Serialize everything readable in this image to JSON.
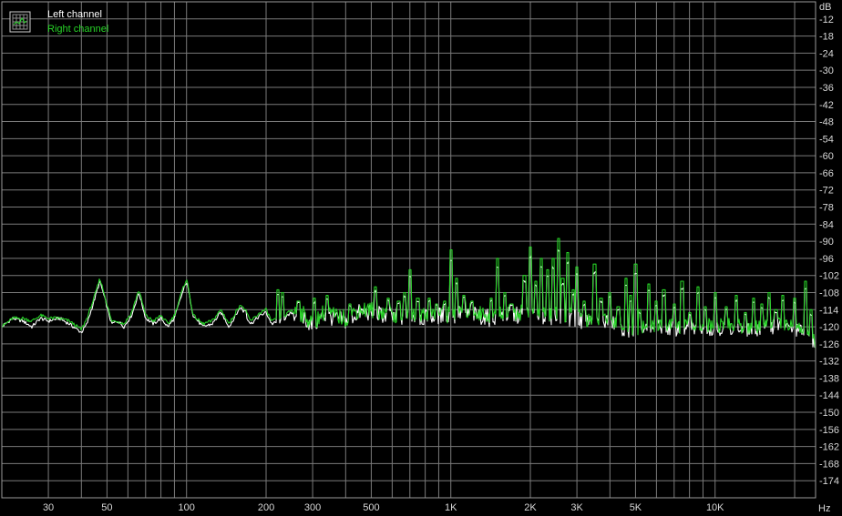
{
  "chart_data": {
    "type": "line",
    "xscale": "log",
    "xlim": [
      20,
      24000
    ],
    "ylim": [
      -180,
      -6
    ],
    "yunit": "dB",
    "xunit": "Hz",
    "grid": true,
    "legend_position": "top-left",
    "background_color": "#000000",
    "grid_color": "#7a7a7a",
    "y_ticks": [
      -12,
      -18,
      -24,
      -30,
      -36,
      -42,
      -48,
      -54,
      -60,
      -66,
      -72,
      -78,
      -84,
      -90,
      -96,
      -102,
      -108,
      -114,
      -120,
      -126,
      -132,
      -138,
      -144,
      -150,
      -156,
      -162,
      -168,
      -174
    ],
    "x_ticks": [
      {
        "value": 30,
        "label": "30"
      },
      {
        "value": 50,
        "label": "50"
      },
      {
        "value": 100,
        "label": "100"
      },
      {
        "value": 200,
        "label": "200"
      },
      {
        "value": 300,
        "label": "300"
      },
      {
        "value": 500,
        "label": "500"
      },
      {
        "value": 1000,
        "label": "1K"
      },
      {
        "value": 2000,
        "label": "2K"
      },
      {
        "value": 3000,
        "label": "3K"
      },
      {
        "value": 5000,
        "label": "5K"
      },
      {
        "value": 10000,
        "label": "10K"
      }
    ],
    "series": [
      {
        "name": "Left channel",
        "color": "#ffffff",
        "points": [
          [
            20,
            -120
          ],
          [
            22,
            -117
          ],
          [
            24,
            -118
          ],
          [
            26,
            -120
          ],
          [
            28,
            -117
          ],
          [
            30,
            -118
          ],
          [
            33,
            -117
          ],
          [
            36,
            -119
          ],
          [
            40,
            -122
          ],
          [
            42,
            -119
          ],
          [
            45,
            -110
          ],
          [
            47,
            -104
          ],
          [
            49,
            -110
          ],
          [
            52,
            -119
          ],
          [
            55,
            -118
          ],
          [
            58,
            -120
          ],
          [
            62,
            -116
          ],
          [
            66,
            -108
          ],
          [
            70,
            -117
          ],
          [
            75,
            -119
          ],
          [
            80,
            -117
          ],
          [
            85,
            -120
          ],
          [
            90,
            -117
          ],
          [
            95,
            -110
          ],
          [
            100,
            -104
          ],
          [
            106,
            -116
          ],
          [
            115,
            -120
          ],
          [
            125,
            -119
          ],
          [
            135,
            -115
          ],
          [
            145,
            -120
          ],
          [
            160,
            -113
          ],
          [
            175,
            -119
          ],
          [
            190,
            -116
          ],
          [
            200,
            -115
          ],
          [
            210,
            -119
          ],
          [
            230,
            -118
          ],
          [
            250,
            -115
          ],
          [
            280,
            -117
          ],
          [
            300,
            -120
          ],
          [
            330,
            -116
          ],
          [
            360,
            -117
          ],
          [
            400,
            -118
          ],
          [
            450,
            -115
          ],
          [
            500,
            -115
          ],
          [
            560,
            -116
          ],
          [
            630,
            -117
          ],
          [
            700,
            -116
          ],
          [
            800,
            -117
          ],
          [
            900,
            -116
          ],
          [
            1000,
            -117
          ],
          [
            1100,
            -115
          ],
          [
            1250,
            -116
          ],
          [
            1400,
            -117
          ],
          [
            1600,
            -116
          ],
          [
            1800,
            -116
          ],
          [
            2000,
            -115
          ],
          [
            2200,
            -116
          ],
          [
            2500,
            -117
          ],
          [
            2800,
            -117
          ],
          [
            3200,
            -118
          ],
          [
            3600,
            -118
          ],
          [
            4000,
            -118
          ],
          [
            4500,
            -121
          ],
          [
            5000,
            -122
          ],
          [
            5600,
            -121
          ],
          [
            6300,
            -120
          ],
          [
            7000,
            -121
          ],
          [
            8000,
            -121
          ],
          [
            9000,
            -120
          ],
          [
            10000,
            -121
          ],
          [
            11200,
            -120
          ],
          [
            12500,
            -121
          ],
          [
            14000,
            -121
          ],
          [
            16000,
            -120
          ],
          [
            18000,
            -120
          ],
          [
            20000,
            -121
          ],
          [
            22000,
            -122
          ],
          [
            24000,
            -127
          ]
        ]
      },
      {
        "name": "Right channel",
        "color": "#27d327",
        "points": [
          [
            20,
            -120
          ],
          [
            22,
            -117
          ],
          [
            24,
            -117
          ],
          [
            26,
            -118
          ],
          [
            28,
            -116
          ],
          [
            30,
            -117
          ],
          [
            33,
            -117
          ],
          [
            36,
            -118
          ],
          [
            40,
            -121
          ],
          [
            42,
            -117
          ],
          [
            45,
            -109
          ],
          [
            47,
            -103
          ],
          [
            49,
            -109
          ],
          [
            52,
            -118
          ],
          [
            55,
            -118
          ],
          [
            58,
            -119
          ],
          [
            62,
            -115
          ],
          [
            66,
            -107
          ],
          [
            70,
            -116
          ],
          [
            75,
            -118
          ],
          [
            80,
            -116
          ],
          [
            85,
            -119
          ],
          [
            90,
            -116
          ],
          [
            95,
            -109
          ],
          [
            100,
            -103
          ],
          [
            106,
            -116
          ],
          [
            115,
            -119
          ],
          [
            125,
            -118
          ],
          [
            135,
            -114
          ],
          [
            145,
            -119
          ],
          [
            160,
            -112
          ],
          [
            175,
            -118
          ],
          [
            190,
            -115
          ],
          [
            200,
            -114
          ],
          [
            210,
            -118
          ],
          [
            230,
            -117
          ],
          [
            250,
            -114
          ],
          [
            280,
            -116
          ],
          [
            300,
            -119
          ],
          [
            330,
            -115
          ],
          [
            360,
            -116
          ],
          [
            400,
            -117
          ],
          [
            450,
            -114
          ],
          [
            500,
            -114
          ],
          [
            560,
            -115
          ],
          [
            630,
            -116
          ],
          [
            700,
            -115
          ],
          [
            800,
            -116
          ],
          [
            900,
            -115
          ],
          [
            1000,
            -116
          ],
          [
            1100,
            -114
          ],
          [
            1250,
            -115
          ],
          [
            1400,
            -116
          ],
          [
            1600,
            -115
          ],
          [
            1800,
            -115
          ],
          [
            2000,
            -114
          ],
          [
            2200,
            -115
          ],
          [
            2500,
            -116
          ],
          [
            2800,
            -116
          ],
          [
            3200,
            -117
          ],
          [
            3600,
            -117
          ],
          [
            4000,
            -117
          ],
          [
            4500,
            -120
          ],
          [
            5000,
            -121
          ],
          [
            5600,
            -120
          ],
          [
            6300,
            -119
          ],
          [
            7000,
            -120
          ],
          [
            8000,
            -120
          ],
          [
            9000,
            -119
          ],
          [
            10000,
            -120
          ],
          [
            11200,
            -119
          ],
          [
            12500,
            -120
          ],
          [
            14000,
            -120
          ],
          [
            16000,
            -119
          ],
          [
            18000,
            -119
          ],
          [
            20000,
            -120
          ],
          [
            22000,
            -121
          ],
          [
            24000,
            -126
          ]
        ]
      }
    ],
    "peaks": [
      {
        "f": 167,
        "db": -114
      },
      {
        "f": 222,
        "db": -107
      },
      {
        "f": 230,
        "db": -108
      },
      {
        "f": 265,
        "db": -111
      },
      {
        "f": 305,
        "db": -110
      },
      {
        "f": 340,
        "db": -109
      },
      {
        "f": 415,
        "db": -112
      },
      {
        "f": 520,
        "db": -106
      },
      {
        "f": 580,
        "db": -110
      },
      {
        "f": 635,
        "db": -111
      },
      {
        "f": 670,
        "db": -108
      },
      {
        "f": 700,
        "db": -100
      },
      {
        "f": 750,
        "db": -110
      },
      {
        "f": 830,
        "db": -110
      },
      {
        "f": 880,
        "db": -112
      },
      {
        "f": 950,
        "db": -111
      },
      {
        "f": 1000,
        "db": -93
      },
      {
        "f": 1050,
        "db": -103
      },
      {
        "f": 1120,
        "db": -109
      },
      {
        "f": 1200,
        "db": -111
      },
      {
        "f": 1420,
        "db": -110
      },
      {
        "f": 1500,
        "db": -96
      },
      {
        "f": 1600,
        "db": -108
      },
      {
        "f": 1700,
        "db": -112
      },
      {
        "f": 1900,
        "db": -102
      },
      {
        "f": 2000,
        "db": -92
      },
      {
        "f": 2100,
        "db": -104
      },
      {
        "f": 2200,
        "db": -96
      },
      {
        "f": 2330,
        "db": -100
      },
      {
        "f": 2440,
        "db": -96
      },
      {
        "f": 2550,
        "db": -89
      },
      {
        "f": 2650,
        "db": -103
      },
      {
        "f": 2770,
        "db": -94
      },
      {
        "f": 2900,
        "db": -107
      },
      {
        "f": 3000,
        "db": -99
      },
      {
        "f": 3200,
        "db": -111
      },
      {
        "f": 3500,
        "db": -98
      },
      {
        "f": 3700,
        "db": -110
      },
      {
        "f": 4000,
        "db": -108
      },
      {
        "f": 4300,
        "db": -113
      },
      {
        "f": 4600,
        "db": -103
      },
      {
        "f": 4800,
        "db": -109
      },
      {
        "f": 5000,
        "db": -98
      },
      {
        "f": 5200,
        "db": -114
      },
      {
        "f": 5600,
        "db": -105
      },
      {
        "f": 6000,
        "db": -111
      },
      {
        "f": 6400,
        "db": -107
      },
      {
        "f": 7000,
        "db": -112
      },
      {
        "f": 7500,
        "db": -104
      },
      {
        "f": 8000,
        "db": -115
      },
      {
        "f": 8600,
        "db": -106
      },
      {
        "f": 9200,
        "db": -113
      },
      {
        "f": 10000,
        "db": -108
      },
      {
        "f": 11000,
        "db": -113
      },
      {
        "f": 12000,
        "db": -109
      },
      {
        "f": 13000,
        "db": -115
      },
      {
        "f": 14000,
        "db": -110
      },
      {
        "f": 15000,
        "db": -112
      },
      {
        "f": 16000,
        "db": -108
      },
      {
        "f": 17000,
        "db": -114
      },
      {
        "f": 18000,
        "db": -109
      },
      {
        "f": 20000,
        "db": -110
      },
      {
        "f": 22000,
        "db": -104
      },
      {
        "f": 23000,
        "db": -114
      }
    ]
  },
  "legend": {
    "left_label": "Left channel",
    "right_label": "Right channel",
    "left_color": "#ffffff",
    "right_color": "#27d327",
    "icon": "spectrum-grid-icon"
  },
  "axis": {
    "y_unit_label": "dB",
    "x_unit_label": "Hz"
  }
}
